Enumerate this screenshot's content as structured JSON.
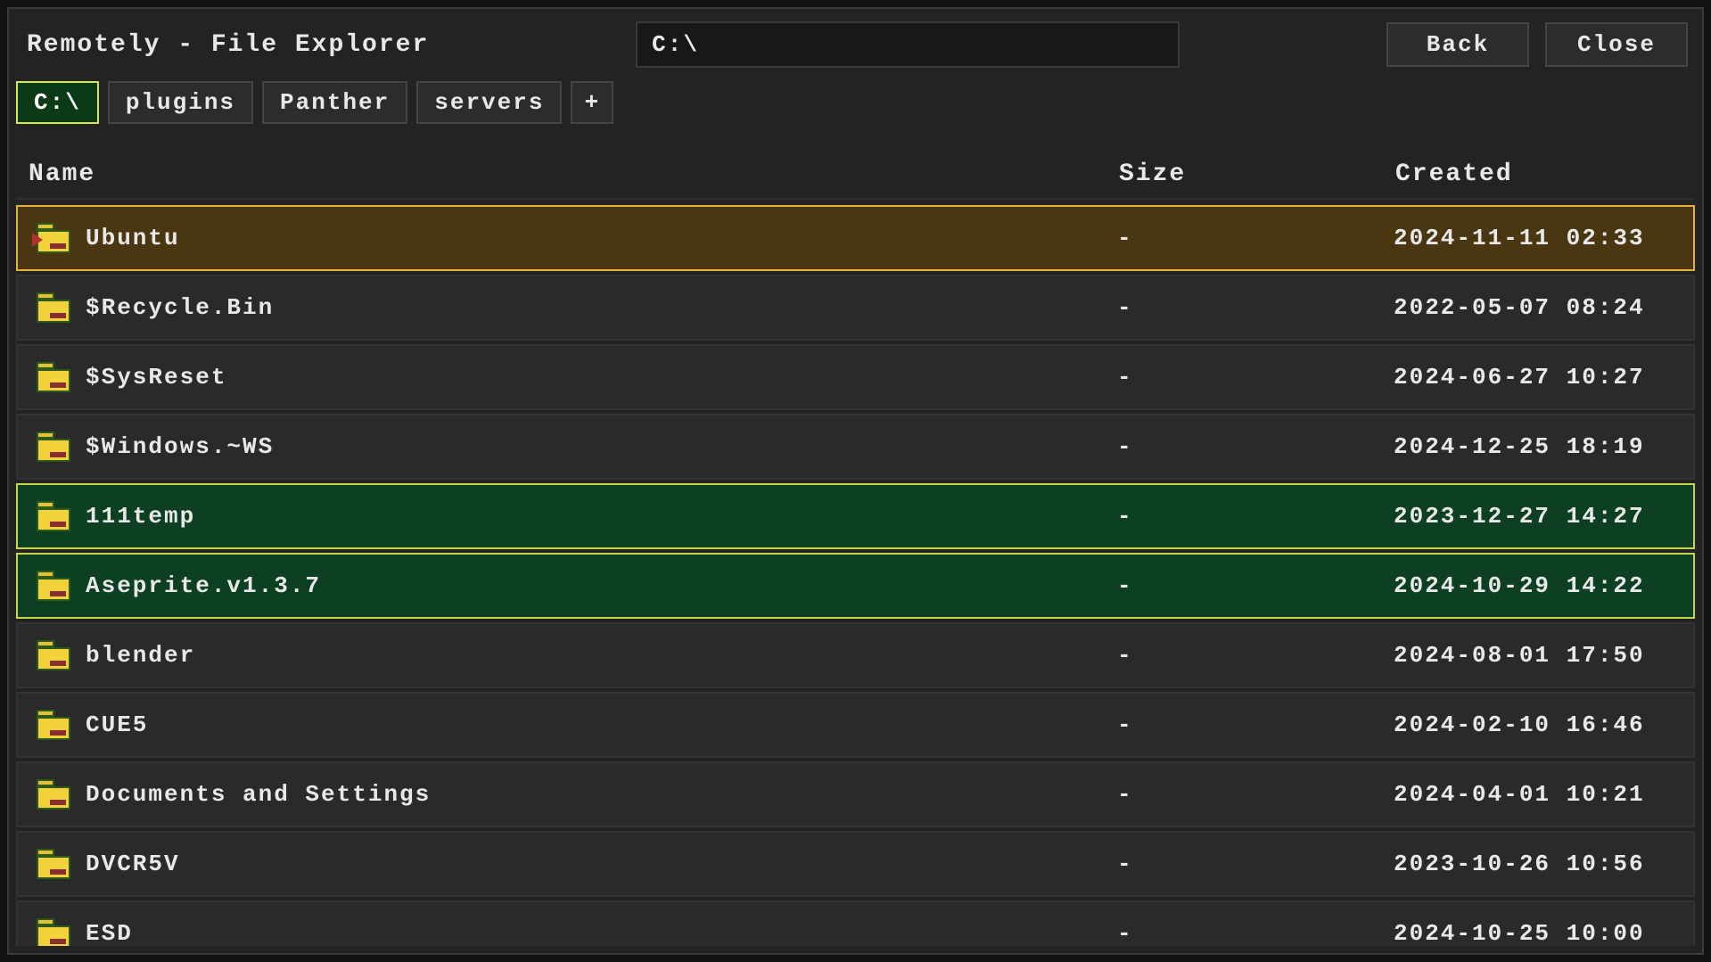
{
  "header": {
    "title": "Remotely - File Explorer",
    "path_value": "C:\\",
    "back_label": "Back",
    "close_label": "Close"
  },
  "tabs": {
    "items": [
      {
        "label": "C:\\",
        "active": true
      },
      {
        "label": "plugins",
        "active": false
      },
      {
        "label": "Panther",
        "active": false
      },
      {
        "label": "servers",
        "active": false
      }
    ],
    "add_label": "+"
  },
  "columns": {
    "name": "Name",
    "size": "Size",
    "created": "Created"
  },
  "rows": [
    {
      "name": "Ubuntu",
      "size": "-",
      "created": "2024-11-11 02:33",
      "highlight": "brown",
      "special": true
    },
    {
      "name": "$Recycle.Bin",
      "size": "-",
      "created": "2022-05-07 08:24"
    },
    {
      "name": "$SysReset",
      "size": "-",
      "created": "2024-06-27 10:27"
    },
    {
      "name": "$Windows.~WS",
      "size": "-",
      "created": "2024-12-25 18:19"
    },
    {
      "name": "111temp",
      "size": "-",
      "created": "2023-12-27 14:27",
      "highlight": "green"
    },
    {
      "name": "Aseprite.v1.3.7",
      "size": "-",
      "created": "2024-10-29 14:22",
      "highlight": "green"
    },
    {
      "name": "blender",
      "size": "-",
      "created": "2024-08-01 17:50"
    },
    {
      "name": "CUE5",
      "size": "-",
      "created": "2024-02-10 16:46"
    },
    {
      "name": "Documents and Settings",
      "size": "-",
      "created": "2024-04-01 10:21"
    },
    {
      "name": "DVCR5V",
      "size": "-",
      "created": "2023-10-26 10:56"
    },
    {
      "name": "ESD",
      "size": "-",
      "created": "2024-10-25 10:00"
    }
  ]
}
